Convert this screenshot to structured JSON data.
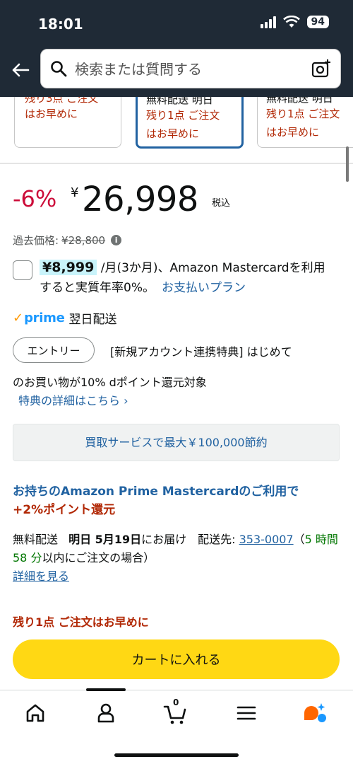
{
  "status_bar": {
    "time": "18:01",
    "battery": "94"
  },
  "search": {
    "placeholder": "検索または質問する"
  },
  "carousel": {
    "cards": [
      {
        "line1": "残り3点 ご注文",
        "line2": "はお早めに"
      },
      {
        "line1": "無料配送 明日",
        "line2": "残り1点 ご注文",
        "line3": "はお早めに"
      },
      {
        "line1": "無料配送 明日",
        "line2": "残り1点 ご注文",
        "line3": "はお早めに"
      }
    ]
  },
  "price": {
    "discount": "-6%",
    "currency": "¥",
    "amount": "26,998",
    "tax_label": "税込",
    "past_label": "過去価格:",
    "past_value": "¥28,800"
  },
  "installment": {
    "price": "¥8,999",
    "text": " /月(3か月)、Amazon Mastercardを利用すると実質年率0%。",
    "link": "お支払いプラン"
  },
  "prime": {
    "check": "✓",
    "logo": "prime",
    "text": "翌日配送"
  },
  "promo": {
    "entry_label": "エントリー",
    "text1": "[新規アカウント連携特典] はじめて",
    "text2": "のお買い物が10% dポイント還元対象",
    "link": "特典の詳細はこちら ›"
  },
  "tradein": {
    "label": "買取サービスで最大￥100,000節約"
  },
  "card_offer": {
    "blue": "お持ちのAmazon Prime Mastercardのご利用で",
    "red": "+2%ポイント還元"
  },
  "delivery": {
    "free": "無料配送",
    "date": "明日 5月19日",
    "arrive": "にお届け　配送先: ",
    "zip": "353-0007",
    "open_paren": "（",
    "countdown": "5 時間 58 分",
    "close": "以内にご注文の場合）",
    "details": "詳細を見る"
  },
  "stock": {
    "text": "残り1点 ご注文はお早めに"
  },
  "cart_button": {
    "label": "カートに入れる"
  },
  "bottom_nav": {
    "cart_count": "0"
  },
  "colors": {
    "header": "#1f2a36",
    "price_red": "#cc0c39",
    "link_blue": "#2162a1",
    "cart_yellow": "#ffd814",
    "prime_orange": "#ff9900",
    "prime_blue": "#1a98ff"
  }
}
